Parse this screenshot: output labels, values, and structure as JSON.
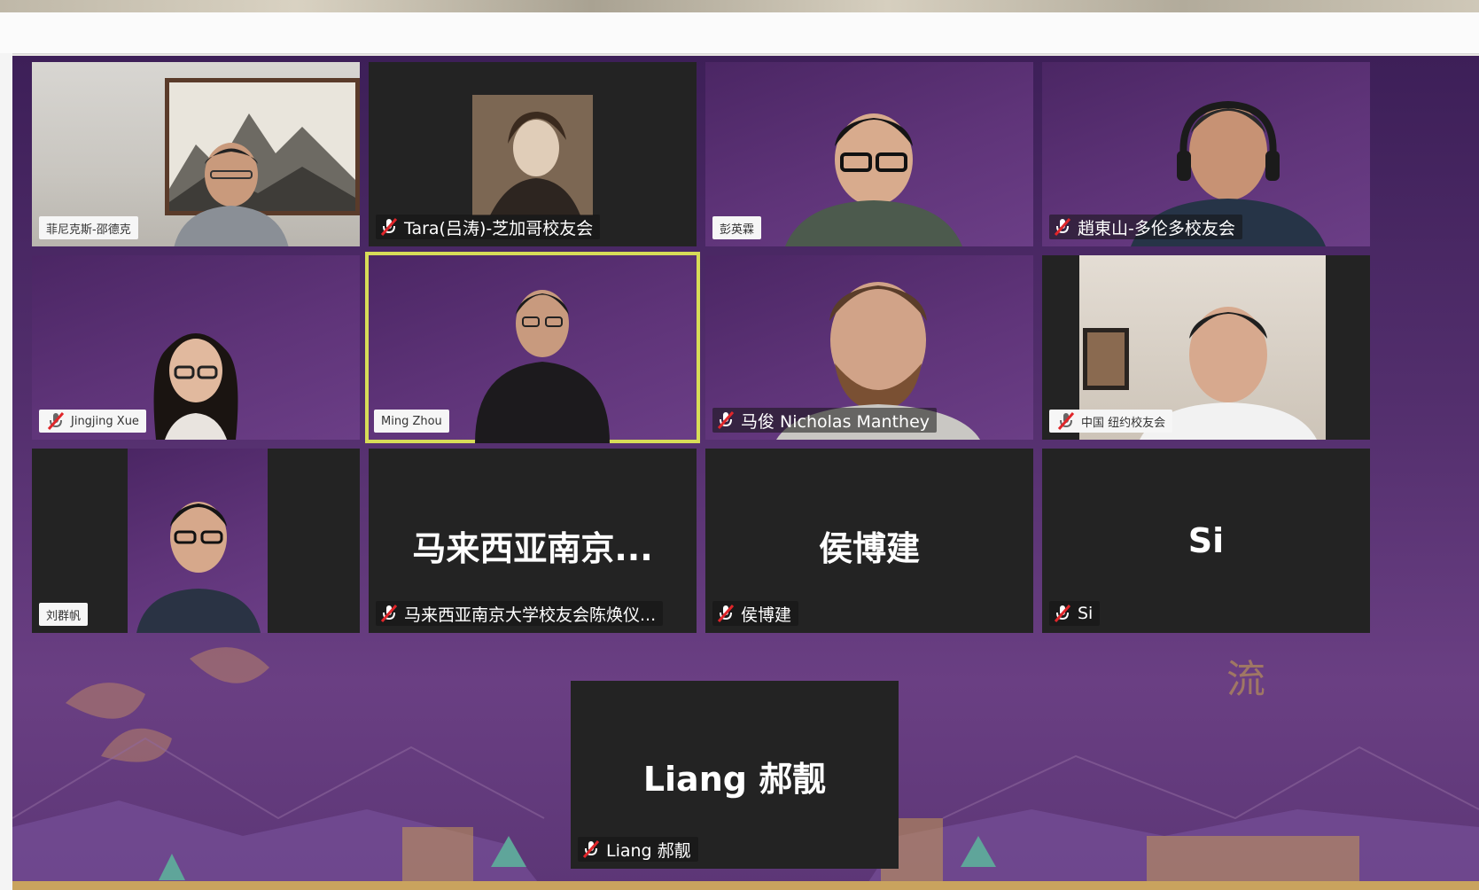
{
  "meeting": {
    "accent_color": "#d7dc58",
    "background_color": "#55306f",
    "background_glyph": "流"
  },
  "participants": [
    {
      "id": "p1",
      "label": "菲尼克斯-邵德克",
      "muted": false,
      "video": true
    },
    {
      "id": "p2",
      "label": "Tara(吕涛)-芝加哥校友会",
      "muted": true,
      "video": true
    },
    {
      "id": "p3",
      "label": "彭英霖",
      "muted": false,
      "video": true
    },
    {
      "id": "p4",
      "label": "趙東山-多伦多校友会",
      "muted": true,
      "video": true
    },
    {
      "id": "p5",
      "label": "Jingjing Xue",
      "muted": true,
      "video": true
    },
    {
      "id": "p6",
      "label": "Ming Zhou",
      "muted": false,
      "video": true,
      "active_speaker": true
    },
    {
      "id": "p7",
      "label": "马俊 Nicholas Manthey",
      "muted": true,
      "video": true
    },
    {
      "id": "p8",
      "label": "中国 纽约校友会",
      "muted": true,
      "video": true
    },
    {
      "id": "p9",
      "label": "刘群帆",
      "muted": false,
      "video": true
    },
    {
      "id": "p10",
      "display_name": "马来西亚南京...",
      "label": "马来西亚南京大学校友会陈焕仪...",
      "muted": true,
      "video": false
    },
    {
      "id": "p11",
      "display_name": "侯博建",
      "label": "侯博建",
      "muted": true,
      "video": false
    },
    {
      "id": "p12",
      "display_name": "Si",
      "label": "Si",
      "muted": true,
      "video": false
    },
    {
      "id": "p13",
      "display_name": "Liang 郝靓",
      "label": "Liang 郝靓",
      "muted": true,
      "video": false
    }
  ]
}
